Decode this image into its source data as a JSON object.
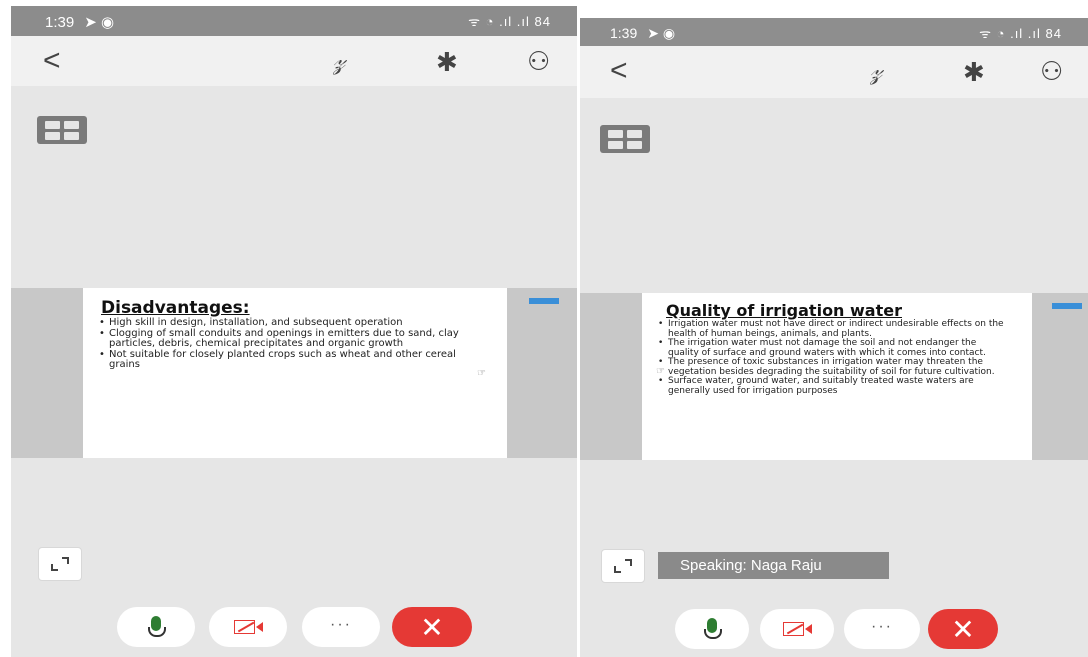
{
  "left_screen": {
    "status_time": "1:39",
    "status_icons": "ᯤ ◔ .ıl .ıl 84",
    "slide": {
      "title": "Disadvantages:",
      "bullets": [
        "High skill in design, installation, and subsequent operation",
        "Clogging of small conduits and openings in emitters due to sand, clay particles, debris, chemical precipitates and organic growth",
        "Not suitable for closely planted crops such as wheat and other cereal grains"
      ]
    }
  },
  "right_screen": {
    "status_time": "1:39",
    "status_icons": "ᯤ ◔ .ıl .ıl 84",
    "slide": {
      "title": "Quality of irrigation water",
      "bullets": [
        "Irrigation water must not have direct or indirect undesirable effects on the health of human beings, animals, and plants.",
        "The irrigation water must not damage the soil and not endanger the quality of surface and ground waters with which it comes into contact.",
        "The presence of toxic substances in irrigation water may threaten the vegetation besides degrading the suitability of soil for future cultivation.",
        "Surface water, ground water, and suitably treated waste waters are generally used for irrigation purposes"
      ]
    },
    "speaking_label": "Speaking: Naga Raju"
  },
  "icons": {
    "back": "<",
    "annotate": "𝓏",
    "bluetooth": "✱",
    "participants": "⚇",
    "more": "···",
    "end_call": "✕"
  },
  "colors": {
    "end_call": "#e53935",
    "mic_active": "#2e7d32",
    "camera_off": "#e53935"
  }
}
